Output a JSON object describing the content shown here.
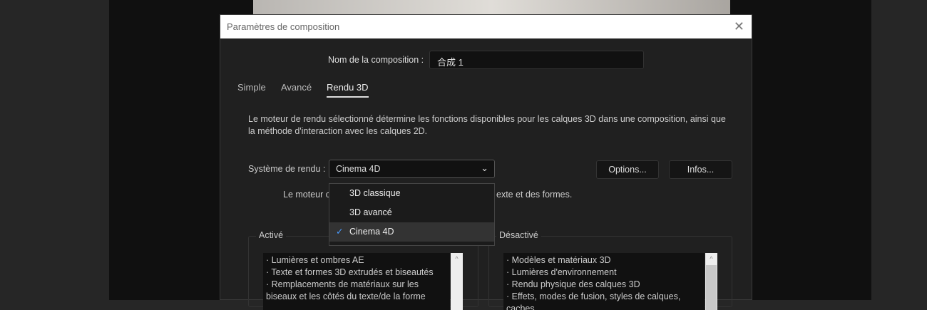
{
  "dialog": {
    "title": "Paramètres de composition",
    "close_icon": "close-icon"
  },
  "name": {
    "label": "Nom de la composition :",
    "value": "合成 1"
  },
  "tabs": [
    {
      "label": "Simple"
    },
    {
      "label": "Avancé"
    },
    {
      "label": "Rendu 3D",
      "active": true
    }
  ],
  "description": "Le moteur de rendu sélectionné détermine les fonctions disponibles pour les calques 3D dans une composition, ainsi que la méthode d'interaction avec les calques 2D.",
  "renderer": {
    "label": "Système de rendu :",
    "value": "Cinema 4D",
    "options": [
      "3D  classique",
      "3D avancé",
      "Cinema 4D"
    ],
    "selected_index": 2
  },
  "buttons": {
    "options": "Options...",
    "infos": "Infos..."
  },
  "hint": {
    "part1": "Le moteur c",
    "part2": "exte et des formes."
  },
  "enabled": {
    "label": "Activé",
    "items": [
      "· Lumières et ombres AE",
      "· Texte et formes 3D extrudés et biseautés",
      "· Remplacements de matériaux sur les biseaux et les côtés du texte/de la forme"
    ]
  },
  "disabled": {
    "label": "Désactivé",
    "items": [
      "· Modèles et matériaux 3D",
      "· Lumières d'environnement",
      "· Rendu physique des calques 3D",
      "· Effets, modes de fusion, styles de calques, caches"
    ]
  },
  "colors": {
    "accent": "#4a9cff"
  }
}
